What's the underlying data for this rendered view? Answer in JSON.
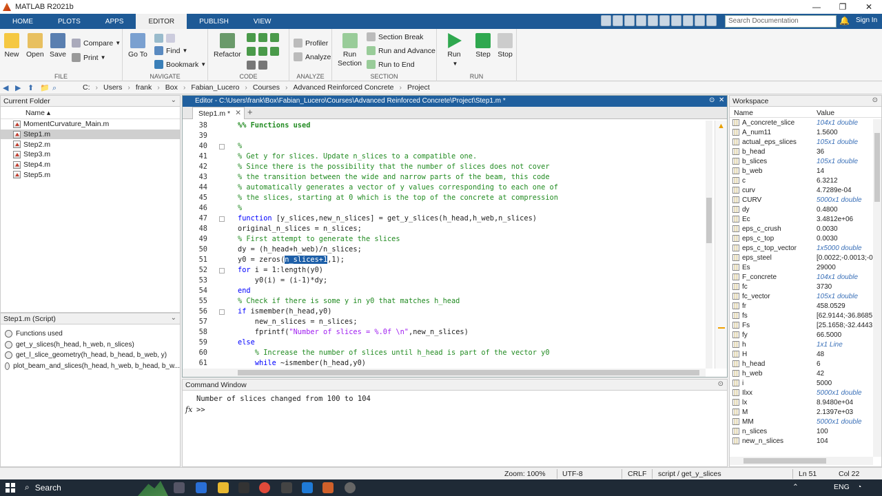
{
  "window": {
    "title": "MATLAB R2021b"
  },
  "tabs": [
    "HOME",
    "PLOTS",
    "APPS",
    "EDITOR",
    "PUBLISH",
    "VIEW"
  ],
  "search": {
    "placeholder": "Search Documentation",
    "signin": "Sign In"
  },
  "toolstrip": {
    "file": {
      "label": "FILE",
      "new": "New",
      "open": "Open",
      "save": "Save",
      "compare": "Compare",
      "print": "Print"
    },
    "navigate": {
      "label": "NAVIGATE",
      "goto_1": "Go To",
      "find": "Find",
      "bookmark": "Bookmark"
    },
    "code": {
      "label": "CODE",
      "refactor": "Refactor"
    },
    "analyze": {
      "label": "ANALYZE",
      "profiler": "Profiler",
      "analyze": "Analyze"
    },
    "section": {
      "label": "SECTION",
      "run_section_1": "Run",
      "run_section_2": "Section",
      "section_break": "Section Break",
      "run_and_advance": "Run and Advance",
      "run_to_end": "Run to End"
    },
    "run": {
      "label": "RUN",
      "run": "Run",
      "step": "Step",
      "stop": "Stop"
    }
  },
  "address": {
    "crumbs": [
      "C:",
      "Users",
      "frank",
      "Box",
      "Fabian_Lucero",
      "Courses",
      "Advanced Reinforced Concrete",
      "Project"
    ]
  },
  "current_folder": {
    "title": "Current Folder",
    "column": "Name",
    "files": [
      "MomentCurvature_Main.m",
      "Step1.m",
      "Step2.m",
      "Step3.m",
      "Step4.m",
      "Step5.m"
    ],
    "selected_index": 1
  },
  "script_panel": {
    "title": "Step1.m  (Script)",
    "items": [
      "Functions used",
      "get_y_slices(h_head, h_web, n_slices)",
      "get_l_slice_geometry(h_head, b_head, b_web, y)",
      "plot_beam_and_slices(h_head, h_web, b_head, b_w..."
    ]
  },
  "editor": {
    "title": "Editor - C:\\Users\\frank\\Box\\Fabian_Lucero\\Courses\\Advanced Reinforced Concrete\\Project\\Step1.m *",
    "tab": "Step1.m *",
    "lines": [
      {
        "n": "38",
        "t": "%% Functions used"
      },
      {
        "n": "39",
        "t": ""
      },
      {
        "n": "40",
        "t": "%"
      },
      {
        "n": "41",
        "t": "% Get y for slices. Update n_slices to a compatible one."
      },
      {
        "n": "42",
        "t": "% Since there is the possibility that the number of slices does not cover"
      },
      {
        "n": "43",
        "t": "% the transition between the wide and narrow parts of the beam, this code"
      },
      {
        "n": "44",
        "t": "% automatically generates a vector of y values corresponding to each one of"
      },
      {
        "n": "45",
        "t": "% the slices, starting at 0 which is the top of the concrete at compression"
      },
      {
        "n": "46",
        "t": "%"
      },
      {
        "n": "47",
        "t": "function [y_slices,new_n_slices] = get_y_slices(h_head,h_web,n_slices)"
      },
      {
        "n": "48",
        "t": "original_n_slices = n_slices;"
      },
      {
        "n": "49",
        "t": "% First attempt to generate the slices"
      },
      {
        "n": "50",
        "t": "dy = (h_head+h_web)/n_slices;"
      },
      {
        "n": "51",
        "t": "y0 = zeros(n_slices+1,1);"
      },
      {
        "n": "52",
        "t": "for i = 1:length(y0)"
      },
      {
        "n": "53",
        "t": "    y0(i) = (i-1)*dy;"
      },
      {
        "n": "54",
        "t": "end"
      },
      {
        "n": "55",
        "t": "% Check if there is some y in y0 that matches h_head"
      },
      {
        "n": "56",
        "t": "if ismember(h_head,y0)"
      },
      {
        "n": "57",
        "t": "    new_n_slices = n_slices;"
      },
      {
        "n": "58",
        "t": "    fprintf(\"Number of slices = %.0f \\n\",new_n_slices)"
      },
      {
        "n": "59",
        "t": "else"
      },
      {
        "n": "60",
        "t": "    % Increase the number of slices until h_head is part of the vector y0"
      },
      {
        "n": "61",
        "t": "    while ~ismember(h_head,y0)"
      }
    ]
  },
  "command_window": {
    "title": "Command Window",
    "output": "Number of slices changed from 100 to 104",
    "prompt": ">>",
    "fx": "fx"
  },
  "workspace": {
    "title": "Workspace",
    "col_name": "Name",
    "col_value": "Value",
    "vars": [
      {
        "name": "A_concrete_slice",
        "value": "104x1 double",
        "it": true
      },
      {
        "name": "A_num11",
        "value": "1.5600",
        "it": false
      },
      {
        "name": "actual_eps_slices",
        "value": "105x1 double",
        "it": true
      },
      {
        "name": "b_head",
        "value": "36",
        "it": false
      },
      {
        "name": "b_slices",
        "value": "105x1 double",
        "it": true
      },
      {
        "name": "b_web",
        "value": "14",
        "it": false
      },
      {
        "name": "c",
        "value": "6.3212",
        "it": false
      },
      {
        "name": "curv",
        "value": "4.7289e-04",
        "it": false
      },
      {
        "name": "CURV",
        "value": "5000x1 double",
        "it": true
      },
      {
        "name": "dy",
        "value": "0.4800",
        "it": false
      },
      {
        "name": "Ec",
        "value": "3.4812e+06",
        "it": false
      },
      {
        "name": "eps_c_crush",
        "value": "0.0030",
        "it": false
      },
      {
        "name": "eps_c_top",
        "value": "0.0030",
        "it": false
      },
      {
        "name": "eps_c_top_vector",
        "value": "1x5000 double",
        "it": true
      },
      {
        "name": "eps_steel",
        "value": "[0.0022;-0.0013;-0.",
        "it": false
      },
      {
        "name": "Es",
        "value": "29000",
        "it": false
      },
      {
        "name": "F_concrete",
        "value": "104x1 double",
        "it": true
      },
      {
        "name": "fc",
        "value": "3730",
        "it": false
      },
      {
        "name": "fc_vector",
        "value": "105x1 double",
        "it": true
      },
      {
        "name": "fr",
        "value": "458.0529",
        "it": false
      },
      {
        "name": "fs",
        "value": "[62.9144;-36.8685;",
        "it": false
      },
      {
        "name": "Fs",
        "value": "[25.1658;-32.4443;",
        "it": false
      },
      {
        "name": "fy",
        "value": "66.5000",
        "it": false
      },
      {
        "name": "h",
        "value": "1x1 Line",
        "it": true
      },
      {
        "name": "H",
        "value": "48",
        "it": false
      },
      {
        "name": "h_head",
        "value": "6",
        "it": false
      },
      {
        "name": "h_web",
        "value": "42",
        "it": false
      },
      {
        "name": "i",
        "value": "5000",
        "it": false
      },
      {
        "name": "Ilxx",
        "value": "5000x1 double",
        "it": true
      },
      {
        "name": "lx",
        "value": "8.9480e+04",
        "it": false
      },
      {
        "name": "M",
        "value": "2.1397e+03",
        "it": false
      },
      {
        "name": "MM",
        "value": "5000x1 double",
        "it": true
      },
      {
        "name": "n_slices",
        "value": "100",
        "it": false
      },
      {
        "name": "new_n_slices",
        "value": "104",
        "it": false
      }
    ]
  },
  "status": {
    "zoom": "Zoom: 100%",
    "encoding": "UTF-8",
    "eol": "CRLF",
    "context": "script / get_y_slices",
    "ln": "Ln  51",
    "col": "Col  22"
  },
  "taskbar": {
    "search": "Search",
    "lang": "ENG"
  }
}
